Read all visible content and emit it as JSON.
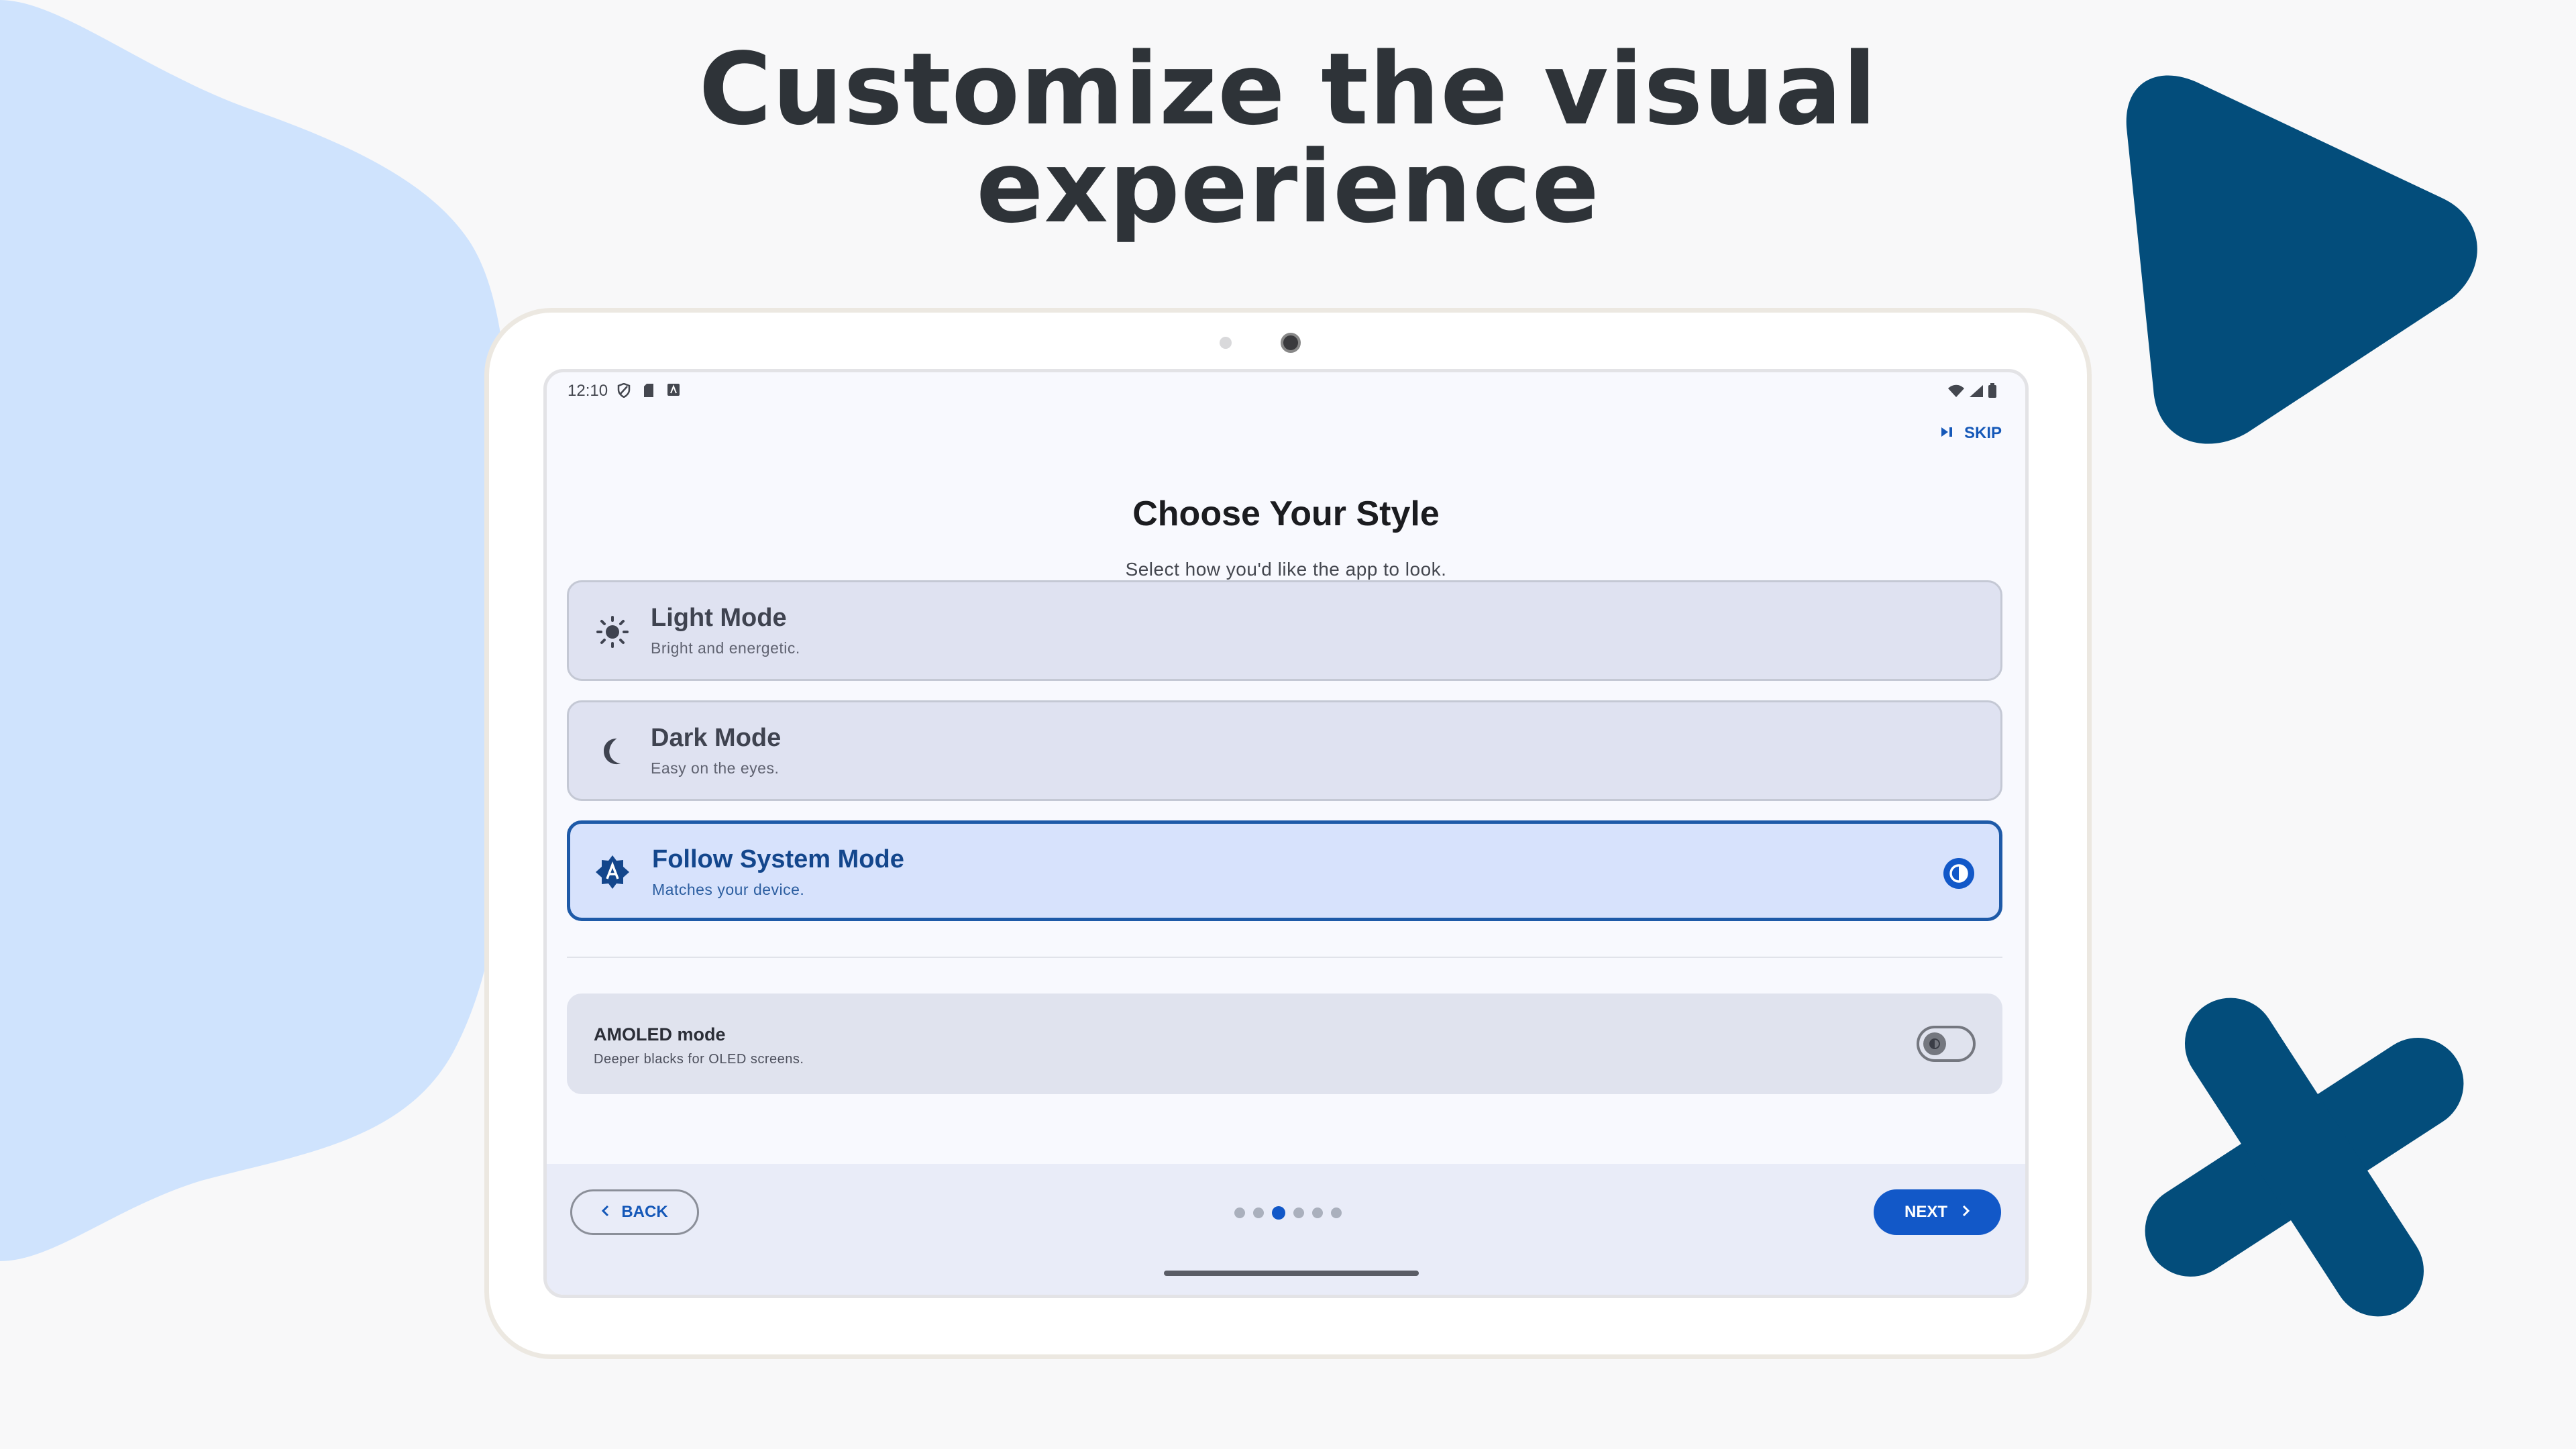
{
  "headline": {
    "line1": "Customize the visual",
    "line2": "experience"
  },
  "colors": {
    "accent": "#1258c8",
    "blob": "#cfe3fd",
    "deco_shapes": "#034d7b",
    "selected_border": "#1e5aa8"
  },
  "status_bar": {
    "time": "12:10",
    "left_icons": [
      "shield-icon",
      "sd-card-icon",
      "app-notification-icon"
    ],
    "right_icons": [
      "wifi-icon",
      "signal-icon",
      "battery-icon"
    ]
  },
  "toolbar": {
    "skip_label": "SKIP",
    "skip_icon": "skip-next-icon"
  },
  "page": {
    "title": "Choose Your Style",
    "subtitle": "Select how you'd like the app to look."
  },
  "options": [
    {
      "title": "Light Mode",
      "description": "Bright and energetic.",
      "icon": "sun-icon",
      "selected": false
    },
    {
      "title": "Dark Mode",
      "description": "Easy on the eyes.",
      "icon": "moon-icon",
      "selected": false
    },
    {
      "title": "Follow System Mode",
      "description": "Matches your device.",
      "icon": "auto-brightness-icon",
      "selected": true
    }
  ],
  "amoled": {
    "title": "AMOLED mode",
    "description": "Deeper blacks for OLED screens.",
    "enabled": false
  },
  "navigation": {
    "back_label": "BACK",
    "next_label": "NEXT",
    "total_steps": 6,
    "current_step": 3
  }
}
